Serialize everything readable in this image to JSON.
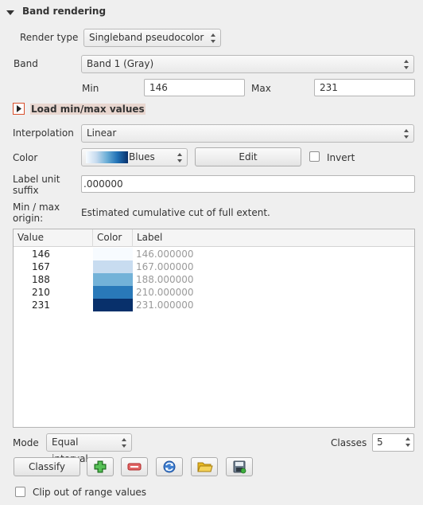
{
  "section": {
    "title": "Band rendering"
  },
  "render_type": {
    "label": "Render type",
    "value": "Singleband pseudocolor"
  },
  "band": {
    "label": "Band",
    "value": "Band 1 (Gray)"
  },
  "min": {
    "label": "Min",
    "value": "146"
  },
  "max": {
    "label": "Max",
    "value": "231"
  },
  "load_minmax": {
    "label": "Load min/max values"
  },
  "interpolation": {
    "label": "Interpolation",
    "value": "Linear"
  },
  "color": {
    "label": "Color",
    "ramp_name": "Blues",
    "edit_label": "Edit",
    "invert_label": "Invert"
  },
  "label_unit_suffix": {
    "label_line1": "Label unit",
    "label_line2": "suffix",
    "value": ".000000"
  },
  "minmax_origin": {
    "label_line1": "Min / max",
    "label_line2": "origin:",
    "value": "Estimated cumulative cut of full extent."
  },
  "table": {
    "headers": [
      "Value",
      "Color",
      "Label"
    ],
    "rows": [
      {
        "value": "146",
        "color": "#f7fbff",
        "label": "146.000000"
      },
      {
        "value": "167",
        "color": "#c8dcf0",
        "label": "167.000000"
      },
      {
        "value": "188",
        "color": "#73b2d8",
        "label": "188.000000"
      },
      {
        "value": "210",
        "color": "#2979b9",
        "label": "210.000000"
      },
      {
        "value": "231",
        "color": "#08306b",
        "label": "231.000000"
      }
    ]
  },
  "mode": {
    "label": "Mode",
    "value": "Equal interval"
  },
  "classes": {
    "label": "Classes",
    "value": "5"
  },
  "classify_label": "Classify",
  "icons": [
    "add-icon",
    "remove-icon",
    "refresh-icon",
    "open-folder-icon",
    "save-icon"
  ],
  "clip": {
    "label": "Clip out of range values"
  }
}
